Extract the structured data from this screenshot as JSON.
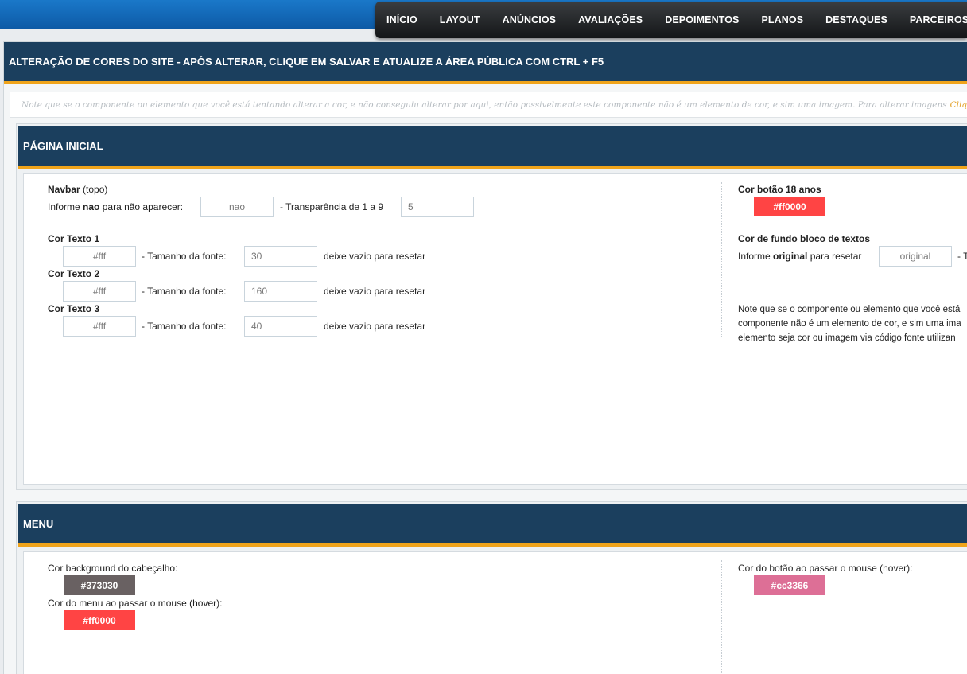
{
  "nav": {
    "items": [
      "INÍCIO",
      "LAYOUT",
      "ANÚNCIOS",
      "AVALIAÇÕES",
      "DEPOIMENTOS",
      "PLANOS",
      "DESTAQUES",
      "PARCEIROS"
    ]
  },
  "page": {
    "title": "ALTERAÇÃO DE CORES DO SITE - APÓS ALTERAR, CLIQUE EM SALVAR E ATUALIZE A ÁREA PÚBLICA COM CTRL + F5",
    "note": "Note que se o componente ou elemento que você está tentando alterar a cor, e não conseguiu alterar por aqui, então possivelmente este componente não é um elemento de cor, e sim uma imagem. Para alterar imagens",
    "note_link": "Clique"
  },
  "home": {
    "title": "PÁGINA INICIAL",
    "navbar": {
      "label_bold": "Navbar",
      "label_rest": "(topo)",
      "hint_pre": "Informe",
      "hint_bold": "nao",
      "hint_post": "para não aparecer:",
      "value": "nao",
      "transp_label": "- Transparência de 1 a 9",
      "transp_value": "5"
    },
    "texts": [
      {
        "label": "Cor Texto 1",
        "color": "#fff",
        "size_label": "- Tamanho da fonte:",
        "size": "30",
        "reset": "deixe vazio para resetar"
      },
      {
        "label": "Cor Texto 2",
        "color": "#fff",
        "size_label": "- Tamanho da fonte:",
        "size": "160",
        "reset": "deixe vazio para resetar"
      },
      {
        "label": "Cor Texto 3",
        "color": "#fff",
        "size_label": "- Tamanho da fonte:",
        "size": "40",
        "reset": "deixe vazio para resetar"
      }
    ],
    "btn18": {
      "label": "Cor botão 18 anos",
      "value": "#ff0000"
    },
    "bg_block": {
      "label": "Cor de fundo bloco de textos",
      "hint_pre": "Informe",
      "hint_bold": "original",
      "hint_post": "para resetar",
      "value": "original",
      "trail": "- T"
    },
    "note_lines": [
      "Note que se o componente ou elemento que você está",
      "componente não é um elemento de cor, e sim uma ima",
      "elemento seja cor ou imagem via código fonte utilizan"
    ]
  },
  "menu": {
    "title": "MENU",
    "header_bg": {
      "label": "Cor background do cabeçalho:",
      "value": "#373030"
    },
    "hover_menu": {
      "label": "Cor do menu ao passar o mouse (hover):",
      "value": "#ff0000"
    },
    "hover_btn": {
      "label": "Cor do botão ao passar o mouse (hover):",
      "value": "#cc3366"
    }
  },
  "colors": {
    "swatch_red": "#ff4444",
    "swatch_dark": "#696162",
    "swatch_pink": "#dd6f96",
    "header": "#1b3f5e",
    "accent": "#f0a41b"
  }
}
